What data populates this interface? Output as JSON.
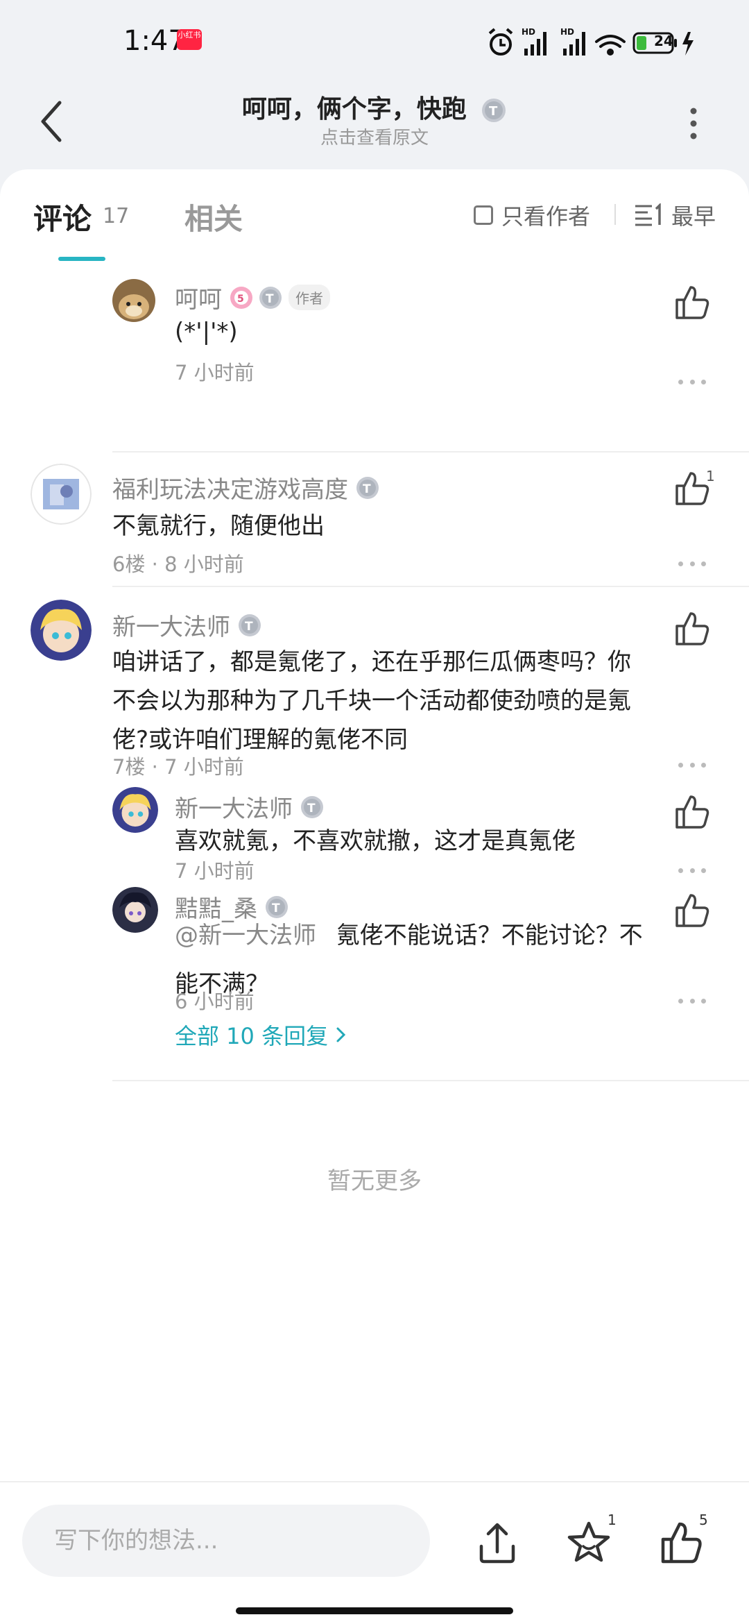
{
  "status_bar": {
    "time": "1:47",
    "app_badge": "小红书",
    "battery": "24"
  },
  "header": {
    "title": "呵呵，俩个字，快跑",
    "subtitle": "点击查看原文"
  },
  "tabs": {
    "comments_label": "评论",
    "comments_count": "17",
    "related_label": "相关",
    "author_only_label": "只看作者",
    "sort_label": "最早"
  },
  "comments": {
    "c1": {
      "name": "呵呵",
      "author_tag": "作者",
      "text": "(*'|'*)",
      "meta": "7 小时前"
    },
    "c2": {
      "name": "福利玩法决定游戏高度",
      "text": "不氪就行，随便他出",
      "meta": "6楼 · 8 小时前",
      "like_count": "1"
    },
    "c3": {
      "name": "新一大法师",
      "text_line1": "咱讲话了，都是氪佬了，还在乎那仨瓜俩枣吗？你",
      "text_line2": "不会以为那种为了几千块一个活动都使劲喷的是氪",
      "text_line3": "佬?或许咱们理解的氪佬不同",
      "meta": "7楼 · 7 小时前"
    },
    "r1": {
      "name": "新一大法师",
      "text": "喜欢就氪，不喜欢就撤，这才是真氪佬",
      "meta": "7 小时前"
    },
    "r2": {
      "name": "黠黠_桑",
      "mention": "@新一大法师",
      "text_line1": "氪佬不能说话？不能讨论？不",
      "text_line2": "能不满？",
      "meta": "6 小时前"
    },
    "view_all": "全部 10 条回复"
  },
  "no_more": "暂无更多",
  "bottom_bar": {
    "input_placeholder": "写下你的想法...",
    "collect_count": "1",
    "like_count": "5"
  },
  "colors": {
    "accent": "#28b5c3",
    "link": "#20a8b8"
  }
}
